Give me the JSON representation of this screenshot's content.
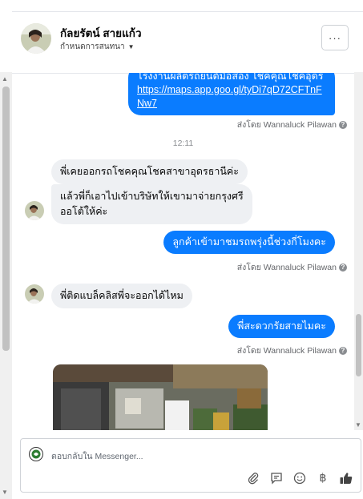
{
  "header": {
    "name": "กัลยรัตน์ สายแก้ว",
    "subtitle": "กำหนดการสนทนา",
    "more_label": "···"
  },
  "messages": {
    "out1_line1": "โรงงานผลิตรถยนต์มือสอง โชคคุณโชคอุดร",
    "out1_link": "https://maps.app.goo.gl/tyDi7qD72CFTnFNw7",
    "sent_by": "ส่งโดย Wannaluck Pilawan",
    "time": "12:11",
    "in1": "พี่เคยออกรถโชคคุณโชคสาขาอุดรธานีค่ะ",
    "in2": "แล้วพี่ก็เอาไปเข้าบริษัทให้เขามาจ่ายกรุงศรีออโต้ให้ค่ะ",
    "out2": "ลูกค้าเข้ามาชมรถพรุ่งนี้ช่วงกี่โมงคะ",
    "in3": "พี่ติดแบล็คลิสพี่จะออกได้ไหม",
    "out3": "พี่สะดวกรัยสายไมคะ"
  },
  "composer": {
    "placeholder": "ตอบกลับใน Messenger..."
  },
  "icons": [
    "paperclip-icon",
    "saved-reply-icon",
    "emoji-icon",
    "baht-icon",
    "thumbs-up-icon",
    "info-icon",
    "more-icon"
  ],
  "colors": {
    "outgoing": "#0a7cff",
    "incoming": "#eef0f3",
    "meta": "#65676b"
  }
}
